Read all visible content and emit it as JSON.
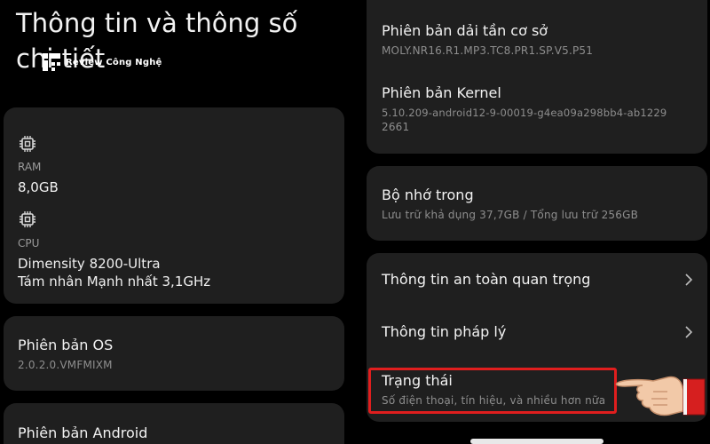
{
  "left_screen": {
    "title": "Thông tin và thông số chi tiết",
    "watermark": "Review Công Nghệ",
    "ram": {
      "label": "RAM",
      "value": "8,0GB",
      "icon": "chip-icon"
    },
    "cpu": {
      "label": "CPU",
      "value_line1": "Dimensity 8200-Ultra",
      "value_line2": "Tám nhân Mạnh nhất 3,1GHz",
      "icon": "chip-icon"
    },
    "os_version": {
      "title": "Phiên bản OS",
      "value": "2.0.2.0.VMFMIXM"
    },
    "android_version": {
      "title": "Phiên bản Android"
    }
  },
  "right_screen": {
    "baseband": {
      "title": "Phiên bản dải tần cơ sở",
      "value": "MOLY.NR16.R1.MP3.TC8.PR1.SP.V5.P51"
    },
    "kernel": {
      "title": "Phiên bản Kernel",
      "value_line1": "5.10.209-android12-9-00019-g4ea09a298bb4-ab1229",
      "value_line2": "2661"
    },
    "storage": {
      "title": "Bộ nhớ trong",
      "value": "Lưu trữ khả dụng  37,7GB / Tổng lưu trữ  256GB"
    },
    "menu": [
      {
        "title": "Thông tin an toàn quan trọng"
      },
      {
        "title": "Thông tin pháp lý"
      },
      {
        "title": "Trạng thái",
        "subtitle": "Số điện thoại, tín hiệu, và nhiều hơn nữa"
      }
    ]
  },
  "colors": {
    "background": "#000000",
    "card": "#1f1f1f",
    "highlight": "#e01e1e",
    "secondary_text": "#9a9a9a"
  }
}
